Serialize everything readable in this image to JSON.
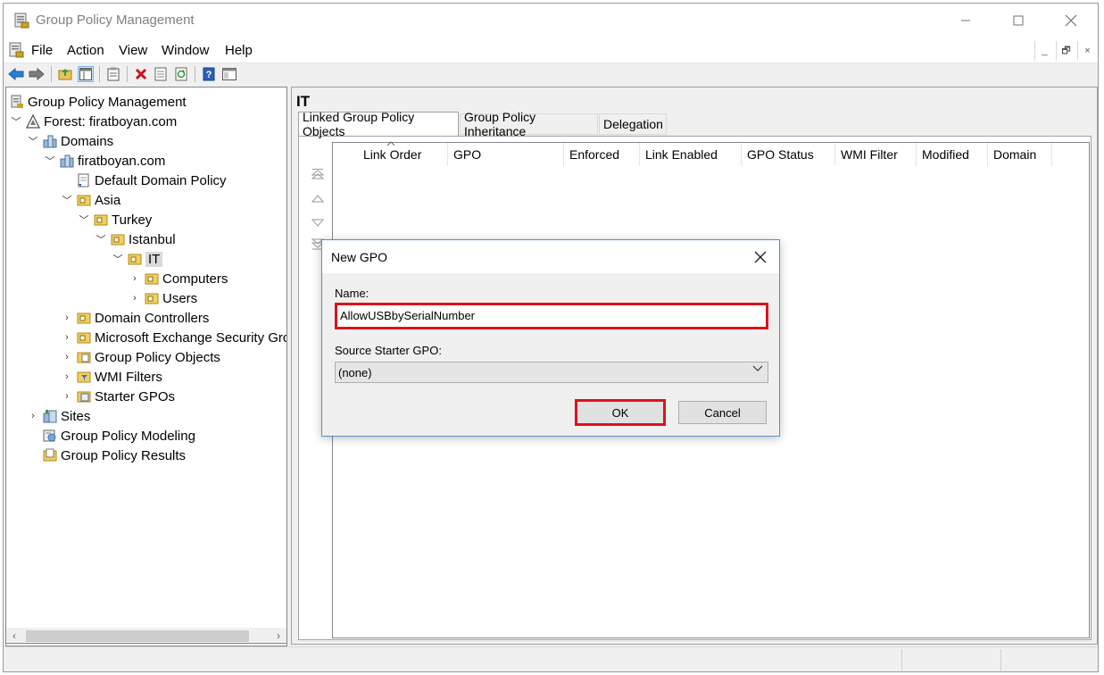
{
  "window": {
    "title": "Group Policy Management",
    "icons": [
      "gpm-app-icon",
      "minimize-icon",
      "maximize-icon",
      "close-icon"
    ]
  },
  "menu": {
    "items": [
      "File",
      "Action",
      "View",
      "Window",
      "Help"
    ],
    "mdi_controls": [
      "_",
      "🗗",
      "×"
    ]
  },
  "toolbar": {
    "buttons": [
      "back-arrow-icon",
      "forward-arrow-icon",
      "up-folder-icon",
      "show-hide-tree-icon",
      "clipboard-icon",
      "delete-icon",
      "properties-icon",
      "refresh-icon",
      "help-icon",
      "console-view-icon"
    ]
  },
  "tree": {
    "nodes": [
      {
        "label": "Group Policy Management",
        "icon": "gpm-icon"
      },
      {
        "label": "Forest: firatboyan.com",
        "icon": "forest-icon"
      },
      {
        "label": "Domains",
        "icon": "domains-icon"
      },
      {
        "label": "firatboyan.com",
        "icon": "domain-icon"
      },
      {
        "label": "Default Domain Policy",
        "icon": "gpo-link-icon"
      },
      {
        "label": "Asia",
        "icon": "ou-folder-icon"
      },
      {
        "label": "Turkey",
        "icon": "ou-folder-icon"
      },
      {
        "label": "Istanbul",
        "icon": "ou-folder-icon"
      },
      {
        "label": "IT",
        "icon": "ou-folder-icon"
      },
      {
        "label": "Computers",
        "icon": "ou-folder-icon"
      },
      {
        "label": "Users",
        "icon": "ou-folder-icon"
      },
      {
        "label": "Domain Controllers",
        "icon": "ou-folder-icon"
      },
      {
        "label": "Microsoft Exchange Security Grc",
        "icon": "ou-folder-icon"
      },
      {
        "label": "Group Policy Objects",
        "icon": "gpo-container-icon"
      },
      {
        "label": "WMI Filters",
        "icon": "wmi-filter-icon"
      },
      {
        "label": "Starter GPOs",
        "icon": "starter-gpo-icon"
      },
      {
        "label": "Sites",
        "icon": "sites-icon"
      },
      {
        "label": "Group Policy Modeling",
        "icon": "modeling-icon"
      },
      {
        "label": "Group Policy Results",
        "icon": "results-icon"
      }
    ],
    "selected": "IT"
  },
  "right_pane": {
    "title": "IT",
    "tabs": [
      "Linked Group Policy Objects",
      "Group Policy Inheritance",
      "Delegation"
    ],
    "active_tab": "Linked Group Policy Objects",
    "columns": [
      "Link Order",
      "GPO",
      "Enforced",
      "Link Enabled",
      "GPO Status",
      "WMI Filter",
      "Modified",
      "Domain"
    ],
    "side_buttons": [
      "move-top-icon",
      "move-up-icon",
      "move-down-icon",
      "move-bottom-icon"
    ]
  },
  "dialog": {
    "title": "New GPO",
    "name_label": "Name:",
    "name_value": "AllowUSBbySerialNumber",
    "source_label": "Source Starter GPO:",
    "source_value": "(none)",
    "ok_label": "OK",
    "cancel_label": "Cancel",
    "highlight_color": "#e0111b"
  }
}
